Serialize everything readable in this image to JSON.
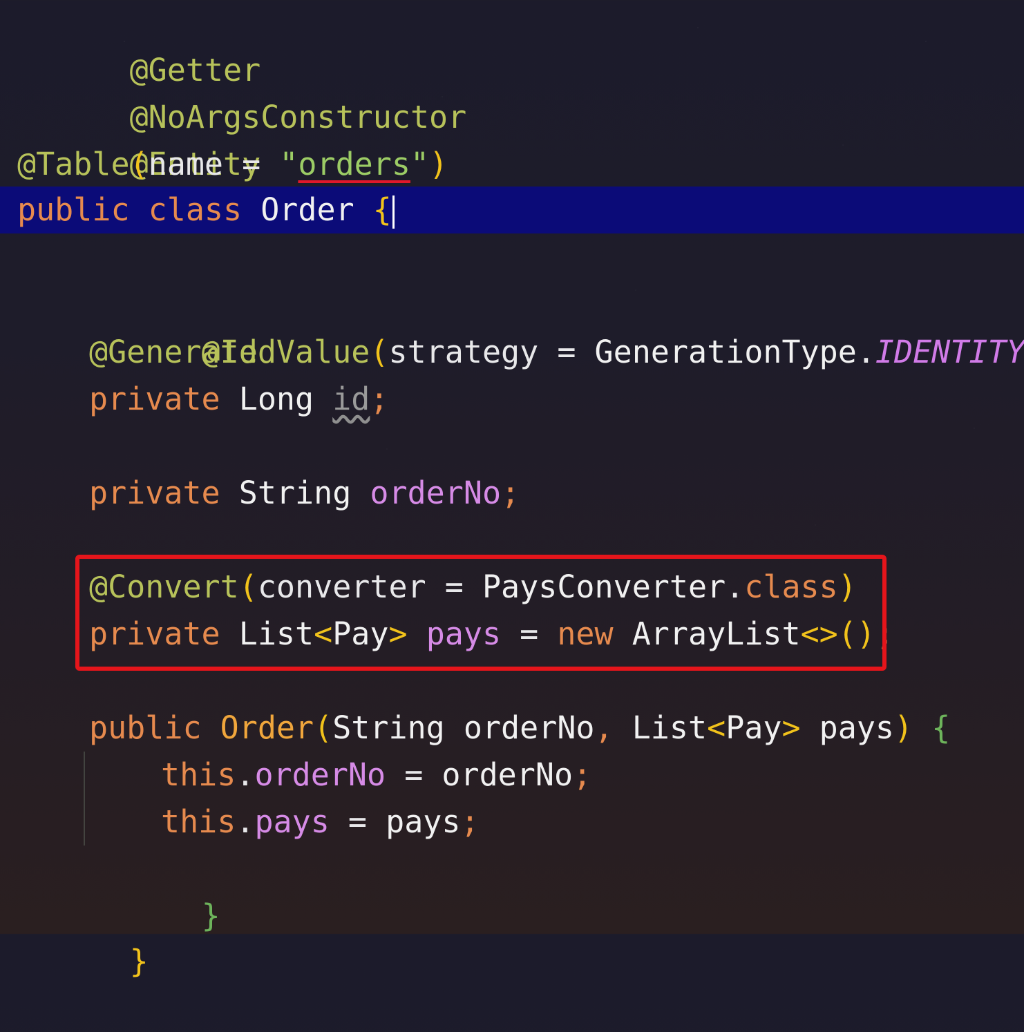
{
  "editor": {
    "language": "java",
    "current_line_index": 4,
    "highlighted_lines": [
      11,
      12
    ],
    "lines": [
      {
        "tokens": [
          "@Getter"
        ]
      },
      {
        "tokens": [
          "@NoArgsConstructor"
        ]
      },
      {
        "tokens": [
          "@Entity"
        ]
      },
      {
        "tokens": [
          "@Table",
          "(",
          "name",
          " = ",
          "\"",
          "orders",
          "\"",
          ")"
        ]
      },
      {
        "tokens": [
          "public",
          " ",
          "class",
          " ",
          "Order",
          " ",
          "{"
        ]
      },
      {
        "tokens": []
      },
      {
        "tokens": [
          "@Id"
        ]
      },
      {
        "tokens": [
          "@GeneratedValue",
          "(",
          "strategy",
          " = ",
          "GenerationType",
          ".",
          "IDENTITY",
          ")"
        ]
      },
      {
        "tokens": [
          "private",
          " ",
          "Long",
          " ",
          "id",
          ";"
        ]
      },
      {
        "tokens": []
      },
      {
        "tokens": [
          "private",
          " ",
          "String",
          " ",
          "orderNo",
          ";"
        ]
      },
      {
        "tokens": [
          "@Convert",
          "(",
          "converter",
          " = ",
          "PaysConverter",
          ".",
          "class",
          ")"
        ]
      },
      {
        "tokens": [
          "private",
          " ",
          "List",
          "<",
          "Pay",
          ">",
          " ",
          "pays",
          " = ",
          "new",
          " ",
          "ArrayList",
          "<>",
          "(",
          ")",
          ";"
        ]
      },
      {
        "tokens": []
      },
      {
        "tokens": [
          "public",
          " ",
          "Order",
          "(",
          "String",
          " ",
          "orderNo",
          ",",
          " ",
          "List",
          "<",
          "Pay",
          ">",
          " ",
          "pays",
          ")",
          " ",
          "{"
        ]
      },
      {
        "tokens": [
          "this",
          ".",
          "orderNo",
          " = ",
          "orderNo",
          ";"
        ]
      },
      {
        "tokens": [
          "this",
          ".",
          "pays",
          " = ",
          "pays",
          ";"
        ]
      },
      {
        "tokens": [
          "}"
        ]
      },
      {
        "tokens": [
          "}"
        ]
      }
    ]
  },
  "colors": {
    "annotation": "#b7c25a",
    "keyword": "#e68a4e",
    "method_name": "#f0a63c",
    "string": "#9ccc65",
    "field": "#d68be6",
    "current_line_background": "#0b0b78",
    "highlight_box": "#e5151b"
  }
}
